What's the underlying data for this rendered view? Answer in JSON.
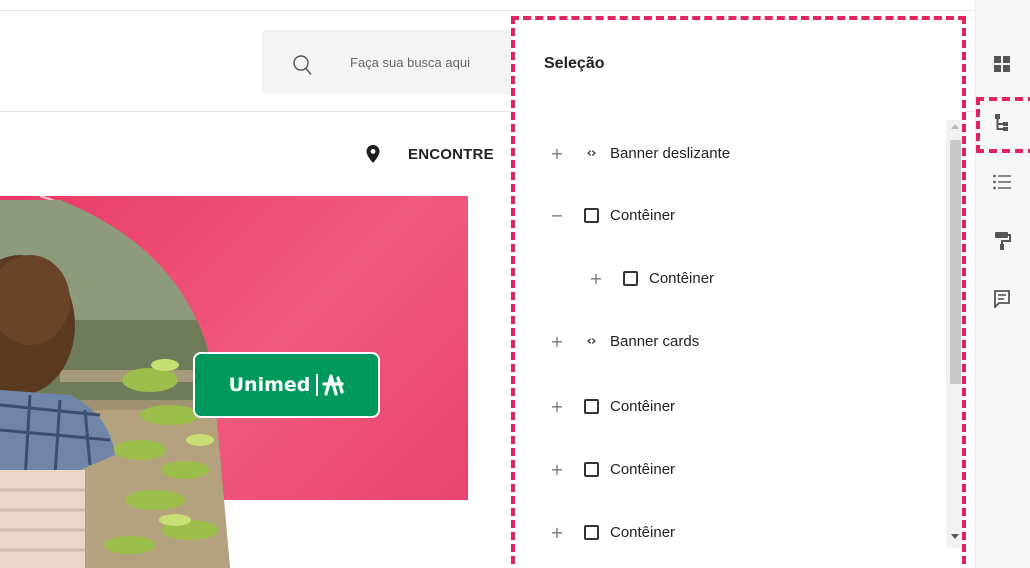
{
  "website": {
    "search_placeholder": "Faça sua busca aqui",
    "nav_link": "ENCONTRE",
    "banner_color": "#ea4a73",
    "brand": {
      "name": "Unimed",
      "color": "#00995d"
    }
  },
  "panel": {
    "title": "Seleção",
    "tree": [
      {
        "toggle": "+",
        "icon": "code-icon",
        "label": "Banner deslizante"
      },
      {
        "toggle": "−",
        "icon": "box-icon",
        "label": "Contêiner"
      },
      {
        "toggle": "+",
        "icon": "box-icon",
        "label": "Contêiner"
      },
      {
        "toggle": "+",
        "icon": "code-icon",
        "label": "Banner cards"
      },
      {
        "toggle": "+",
        "icon": "box-icon",
        "label": "Contêiner"
      },
      {
        "toggle": "+",
        "icon": "box-icon",
        "label": "Contêiner"
      },
      {
        "toggle": "+",
        "icon": "box-icon",
        "label": "Contêiner"
      }
    ]
  },
  "toolbar": {
    "items": [
      "grid-icon",
      "tree-structure-icon",
      "list-icon",
      "paint-roller-icon",
      "comment-icon"
    ],
    "active": "tree-structure-icon"
  },
  "highlight_color": "#e0245e"
}
